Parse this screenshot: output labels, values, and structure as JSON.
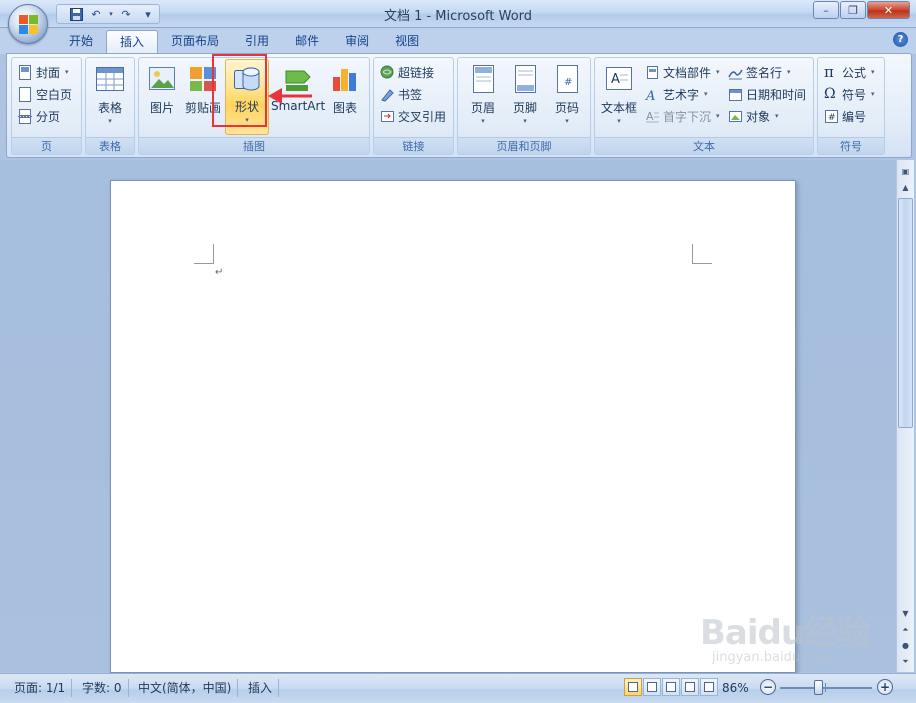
{
  "window": {
    "title": "文档 1 - Microsoft Word",
    "minimize": "–",
    "restore": "❐",
    "close": "✕"
  },
  "quick_access": {
    "save": "💾",
    "undo": "↶",
    "redo": "↷",
    "customize": "▾"
  },
  "tabs": [
    "开始",
    "插入",
    "页面布局",
    "引用",
    "邮件",
    "审阅",
    "视图"
  ],
  "active_tab": "插入",
  "help": "?",
  "ribbon": {
    "pages": {
      "label": "页",
      "items": [
        "封面",
        "空白页",
        "分页"
      ]
    },
    "table": {
      "label": "表格",
      "button": "表格"
    },
    "illustrations": {
      "label": "插图",
      "picture": "图片",
      "clipart": "剪贴画",
      "shapes": "形状",
      "smartart": "SmartArt",
      "chart": "图表"
    },
    "links": {
      "label": "链接",
      "items": [
        "超链接",
        "书签",
        "交叉引用"
      ]
    },
    "header_footer": {
      "label": "页眉和页脚",
      "header": "页眉",
      "footer": "页脚",
      "page_number": "页码"
    },
    "text": {
      "label": "文本",
      "textbox": "文本框",
      "quick_parts": "文档部件",
      "wordart": "艺术字",
      "dropcap": "首字下沉",
      "signature": "签名行",
      "datetime": "日期和时间",
      "object": "对象"
    },
    "symbols": {
      "label": "符号",
      "equation": "公式",
      "symbol": "符号",
      "number": "编号"
    }
  },
  "document": {
    "paragraph_mark": "↵"
  },
  "statusbar": {
    "page": "页面: 1/1",
    "words": "字数: 0",
    "language": "中文(简体，中国)",
    "mode": "插入",
    "zoom": "86%",
    "zoom_minus": "−",
    "zoom_plus": "+"
  },
  "watermark": {
    "brand": "Baidu经验",
    "url": "jingyan.baidu.com"
  },
  "colors": {
    "accent_red": "#e8333b",
    "ribbon_blue": "#bdd1ec",
    "highlight_gold": "#ffd35e"
  }
}
